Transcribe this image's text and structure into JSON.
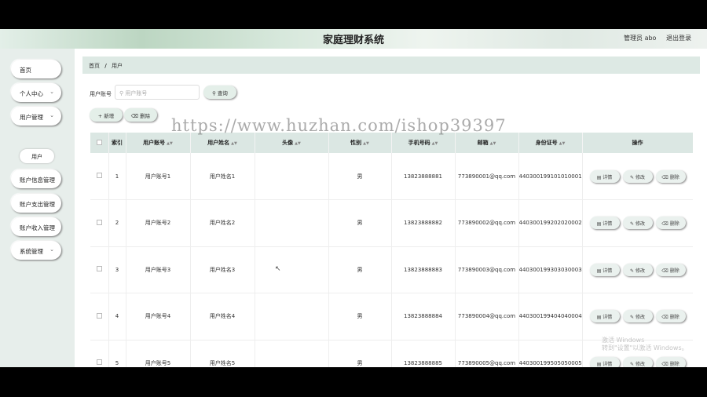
{
  "app": {
    "title": "家庭理财系统"
  },
  "header": {
    "role": "管理员 abo",
    "logout": "退出登录"
  },
  "sidebar": {
    "items": [
      {
        "label": "首页",
        "chevron": ""
      },
      {
        "label": "个人中心",
        "chevron": "⌄"
      },
      {
        "label": "用户管理",
        "chevron": "⌄"
      },
      {
        "label": "账户信息管理",
        "chevron": ""
      },
      {
        "label": "账户支出管理",
        "chevron": ""
      },
      {
        "label": "账户收入管理",
        "chevron": ""
      },
      {
        "label": "系统管理",
        "chevron": "⌄"
      }
    ],
    "sub_item": "用户"
  },
  "breadcrumb": {
    "home": "首页",
    "separator": "/",
    "current": "用户"
  },
  "search": {
    "label": "用户账号",
    "placeholder": "用户账号",
    "button": "查询"
  },
  "actions": {
    "add": "新增",
    "delete": "删除"
  },
  "table": {
    "headers": [
      "索引",
      "用户账号",
      "用户姓名",
      "头像",
      "性别",
      "手机号码",
      "邮箱",
      "身份证号",
      "操作"
    ],
    "rows": [
      {
        "index": "1",
        "account": "用户账号1",
        "name": "用户姓名1",
        "avatar": "",
        "gender": "男",
        "phone": "13823888881",
        "email": "773890001@qq.com",
        "id_card": "440300199101010001"
      },
      {
        "index": "2",
        "account": "用户账号2",
        "name": "用户姓名2",
        "avatar": "",
        "gender": "男",
        "phone": "13823888882",
        "email": "773890002@qq.com",
        "id_card": "440300199202020002"
      },
      {
        "index": "3",
        "account": "用户账号3",
        "name": "用户姓名3",
        "avatar": "",
        "gender": "男",
        "phone": "13823888883",
        "email": "773890003@qq.com",
        "id_card": "440300199303030003"
      },
      {
        "index": "4",
        "account": "用户账号4",
        "name": "用户姓名4",
        "avatar": "",
        "gender": "男",
        "phone": "13823888884",
        "email": "773890004@qq.com",
        "id_card": "440300199404040004"
      },
      {
        "index": "5",
        "account": "用户账号5",
        "name": "用户姓名5",
        "avatar": "",
        "gender": "男",
        "phone": "13823888885",
        "email": "773890005@qq.com",
        "id_card": "440300199505050005"
      }
    ],
    "row_buttons": {
      "detail": "详情",
      "edit": "修改",
      "delete": "删除"
    }
  },
  "overlay": {
    "watermark": "https://www.huzhan.com/ishop39397",
    "activation_line1": "激活 Windows",
    "activation_line2": "转到\"设置\"以激活 Windows。"
  }
}
